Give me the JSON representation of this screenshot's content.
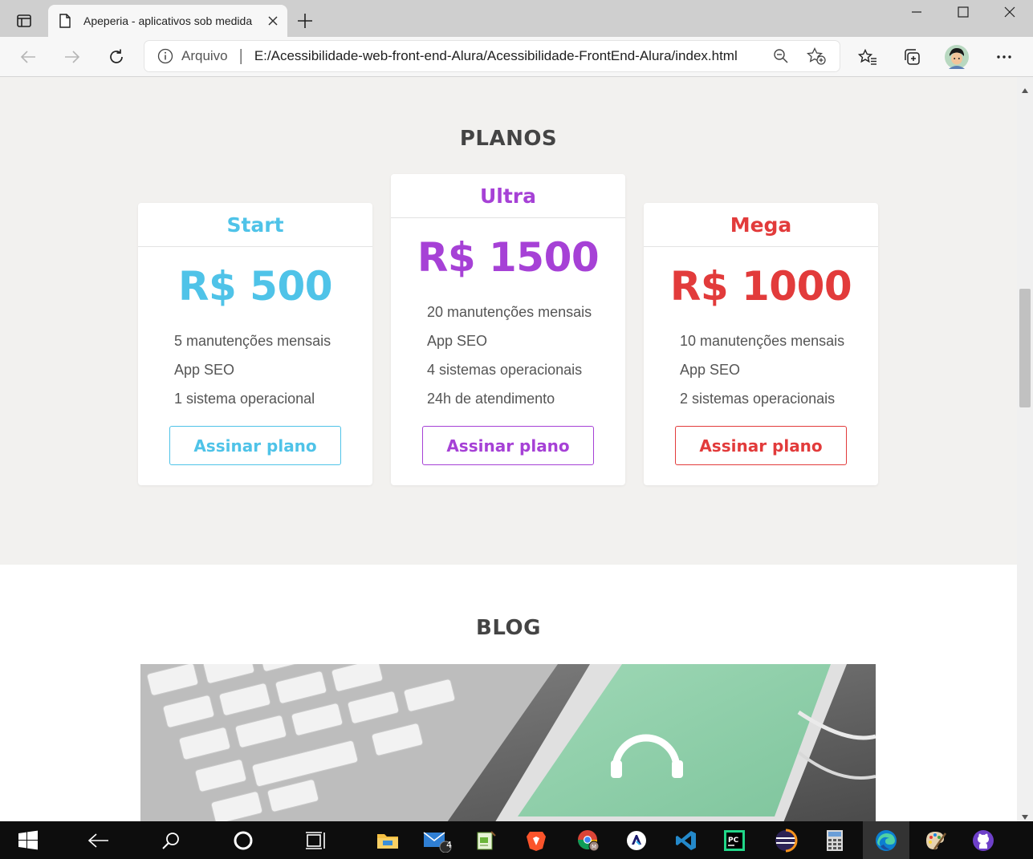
{
  "browser": {
    "tab_title": "Apeperia - aplicativos sob medida",
    "address_label": "Arquivo",
    "address_separator": "|",
    "url": "E:/Acessibilidade-web-front-end-Alura/Acessibilidade-FrontEnd-Alura/index.html"
  },
  "page": {
    "plans_title": "PLANOS",
    "blog_title": "BLOG",
    "plans": [
      {
        "name": "Start",
        "price": "R$ 500",
        "color": "#4fc3e8",
        "features": [
          "5 manutenções mensais",
          "App SEO",
          "1 sistema operacional"
        ],
        "button": "Assinar plano"
      },
      {
        "name": "Ultra",
        "price": "R$ 1500",
        "color": "#a641d6",
        "features": [
          "20 manutenções mensais",
          "App SEO",
          "4 sistemas operacionais",
          "24h de atendimento"
        ],
        "button": "Assinar plano"
      },
      {
        "name": "Mega",
        "price": "R$ 1000",
        "color": "#e23b3b",
        "features": [
          "10 manutenções mensais",
          "App SEO",
          "2 sistemas operacionais"
        ],
        "button": "Assinar plano"
      }
    ]
  },
  "taskbar": {
    "mail_badge": "4",
    "items": [
      "start-icon",
      "back-icon",
      "search-icon",
      "cortana-icon",
      "task-view-icon",
      "file-explorer-icon",
      "mail-icon",
      "notepad-icon",
      "brave-icon",
      "chrome-icon",
      "app-icon",
      "vscode-icon",
      "pycharm-icon",
      "eclipse-icon",
      "calculator-icon",
      "edge-icon",
      "paint-icon",
      "github-icon"
    ]
  }
}
